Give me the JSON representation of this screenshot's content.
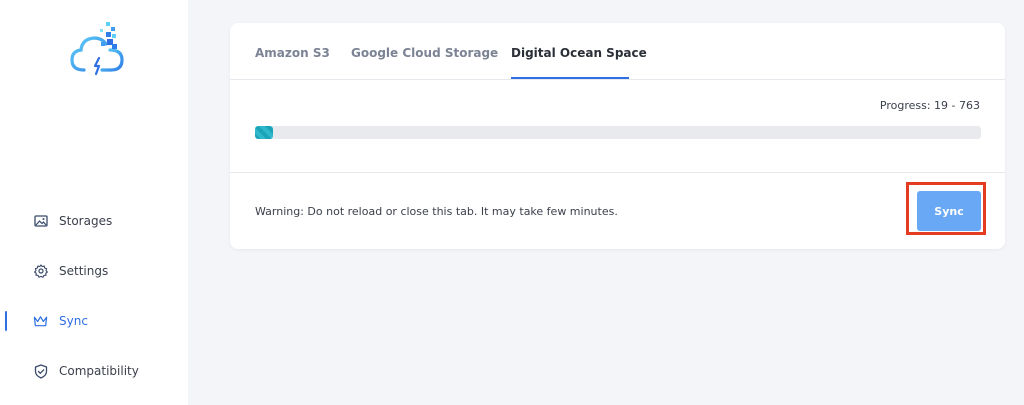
{
  "sidebar": {
    "logo_icon": "cloud-sync-logo-icon",
    "items": [
      {
        "label": "Storages",
        "icon": "image-icon"
      },
      {
        "label": "Settings",
        "icon": "gear-icon"
      },
      {
        "label": "Sync",
        "icon": "crown-icon",
        "active": true
      },
      {
        "label": "Compatibility",
        "icon": "shield-check-icon"
      }
    ]
  },
  "tabs": [
    {
      "label": "Amazon S3"
    },
    {
      "label": "Google Cloud Storage"
    },
    {
      "label": "Digital Ocean Space",
      "active": true
    }
  ],
  "progress": {
    "text": "Progress: 19 - 763",
    "current": 19,
    "total": 763,
    "fraction": 0.025
  },
  "warning": "Warning: Do not reload or close this tab. It may take few minutes.",
  "sync_button": {
    "label": "Sync"
  },
  "colors": {
    "accent": "#2f6fe4",
    "button": "#69a8f5",
    "progress_fill": "#1ba3b9",
    "highlight": "#e43b23"
  }
}
